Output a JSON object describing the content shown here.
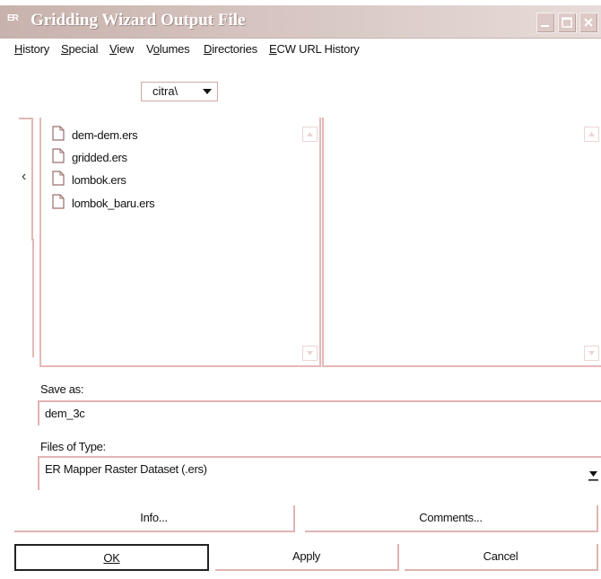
{
  "window": {
    "app_icon_text": "ER",
    "title": "Gridding Wizard Output File"
  },
  "menu": {
    "items": [
      {
        "label": "History",
        "mnemonic": "H"
      },
      {
        "label": "Special",
        "mnemonic": "S"
      },
      {
        "label": "View",
        "mnemonic": "V"
      },
      {
        "label": "Volumes",
        "mnemonic": "o"
      },
      {
        "label": "Directories",
        "mnemonic": "D"
      },
      {
        "label": "ECW URL History",
        "mnemonic": "E"
      }
    ]
  },
  "directory": {
    "current": "citra\\"
  },
  "files": [
    {
      "name": "dem-dem.ers"
    },
    {
      "name": "gridded.ers"
    },
    {
      "name": "lombok.ers"
    },
    {
      "name": "lombok_baru.ers"
    }
  ],
  "save_as": {
    "label": "Save as:",
    "value": "dem_3c"
  },
  "file_type": {
    "label": "Files of Type:",
    "value": "ER Mapper Raster Dataset (.ers)"
  },
  "buttons": {
    "info": "Info...",
    "comments": "Comments...",
    "ok": "OK",
    "apply": "Apply",
    "cancel": "Cancel"
  },
  "icons": {
    "back": "chevron-left-icon",
    "file": "document-icon"
  },
  "colors": {
    "titlebar": "#c8b2ad",
    "border_accent": "#e1b8b6"
  }
}
